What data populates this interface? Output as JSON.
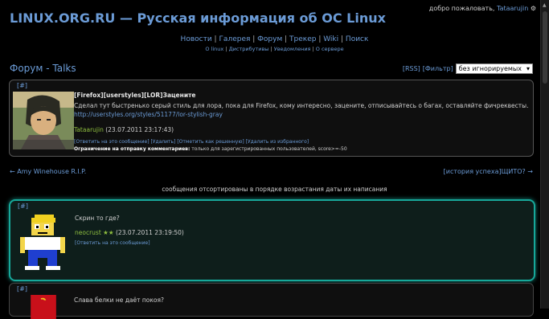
{
  "header": {
    "site_title": "LINUX.ORG.RU — Русская информация об ОС Linux",
    "welcome": "добро пожаловать,",
    "username": "Tataarujin"
  },
  "nav": {
    "items": [
      "Новости",
      "Галерея",
      "Форум",
      "Трекер",
      "Wiki",
      "Поиск"
    ],
    "sub_items": [
      "О linux",
      "Дистрибутивы",
      "Уведомления",
      "О сервере"
    ]
  },
  "forum": {
    "title": "Форум - Talks",
    "rss": "[RSS]",
    "filter": "[Фильтр]",
    "select_value": "без игнорируемых"
  },
  "topic": {
    "ref": "[#]",
    "title": "[Firefox][userstyles][LOR]Зацените",
    "body": "Сделал тут быстренько серый стиль для лора, пока для Firefox, кому интересно, зацените, отписывайтесь о багах, оставляйте фичреквесты.",
    "link": "http://userstyles.org/styles/51177/lor-stylish-gray",
    "author": "Tataarujin",
    "date": "(23.07.2011 23:17:43)",
    "actions": [
      "[Ответить на это сообщение]",
      "[Удалить]",
      "[Отметить как решенную]",
      "[Удалить из избранного]"
    ],
    "restriction_label": "Ограничение на отправку комментариев:",
    "restriction_text": "только для зарегистрированных пользователей, score>=-50"
  },
  "pager": {
    "prev": "← Amy Winehouse R.I.P.",
    "next": "[история успеха]ЩИТО? →"
  },
  "sort_note": "сообщения отсортированы в порядке возрастания даты их написания",
  "comments": [
    {
      "ref": "[#]",
      "body": "Скрин то где?",
      "author": "neocrust",
      "stars": "★★",
      "date": "(23.07.2011 23:19:50)",
      "reply": "[Ответить на это сообщение]"
    },
    {
      "ref": "[#]",
      "body": "Слава белки не даёт покоя?"
    }
  ],
  "colors": {
    "link": "#6b9bd6",
    "highlight_border": "#17a89a",
    "author": "#8fbf3f"
  }
}
